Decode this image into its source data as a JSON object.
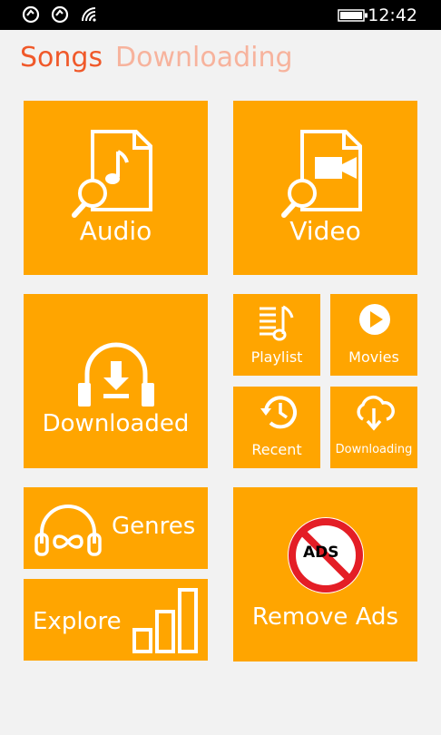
{
  "status_bar": {
    "time": "12:42"
  },
  "pivot": {
    "active": "Songs",
    "inactive": "Downloading"
  },
  "tiles": {
    "audio": "Audio",
    "video": "Video",
    "downloaded": "Downloaded",
    "playlist": "Playlist",
    "movies": "Movies",
    "recent": "Recent",
    "downloading": "Downloading",
    "genres": "Genres",
    "explore": "Explore",
    "remove_ads": "Remove Ads",
    "ads_badge": "ADS"
  },
  "colors": {
    "tile": "#ffa500",
    "accent": "#f0592a",
    "accent_light": "#f7b39d",
    "background": "#f2f2f2",
    "no_sign": "#e41e26"
  }
}
